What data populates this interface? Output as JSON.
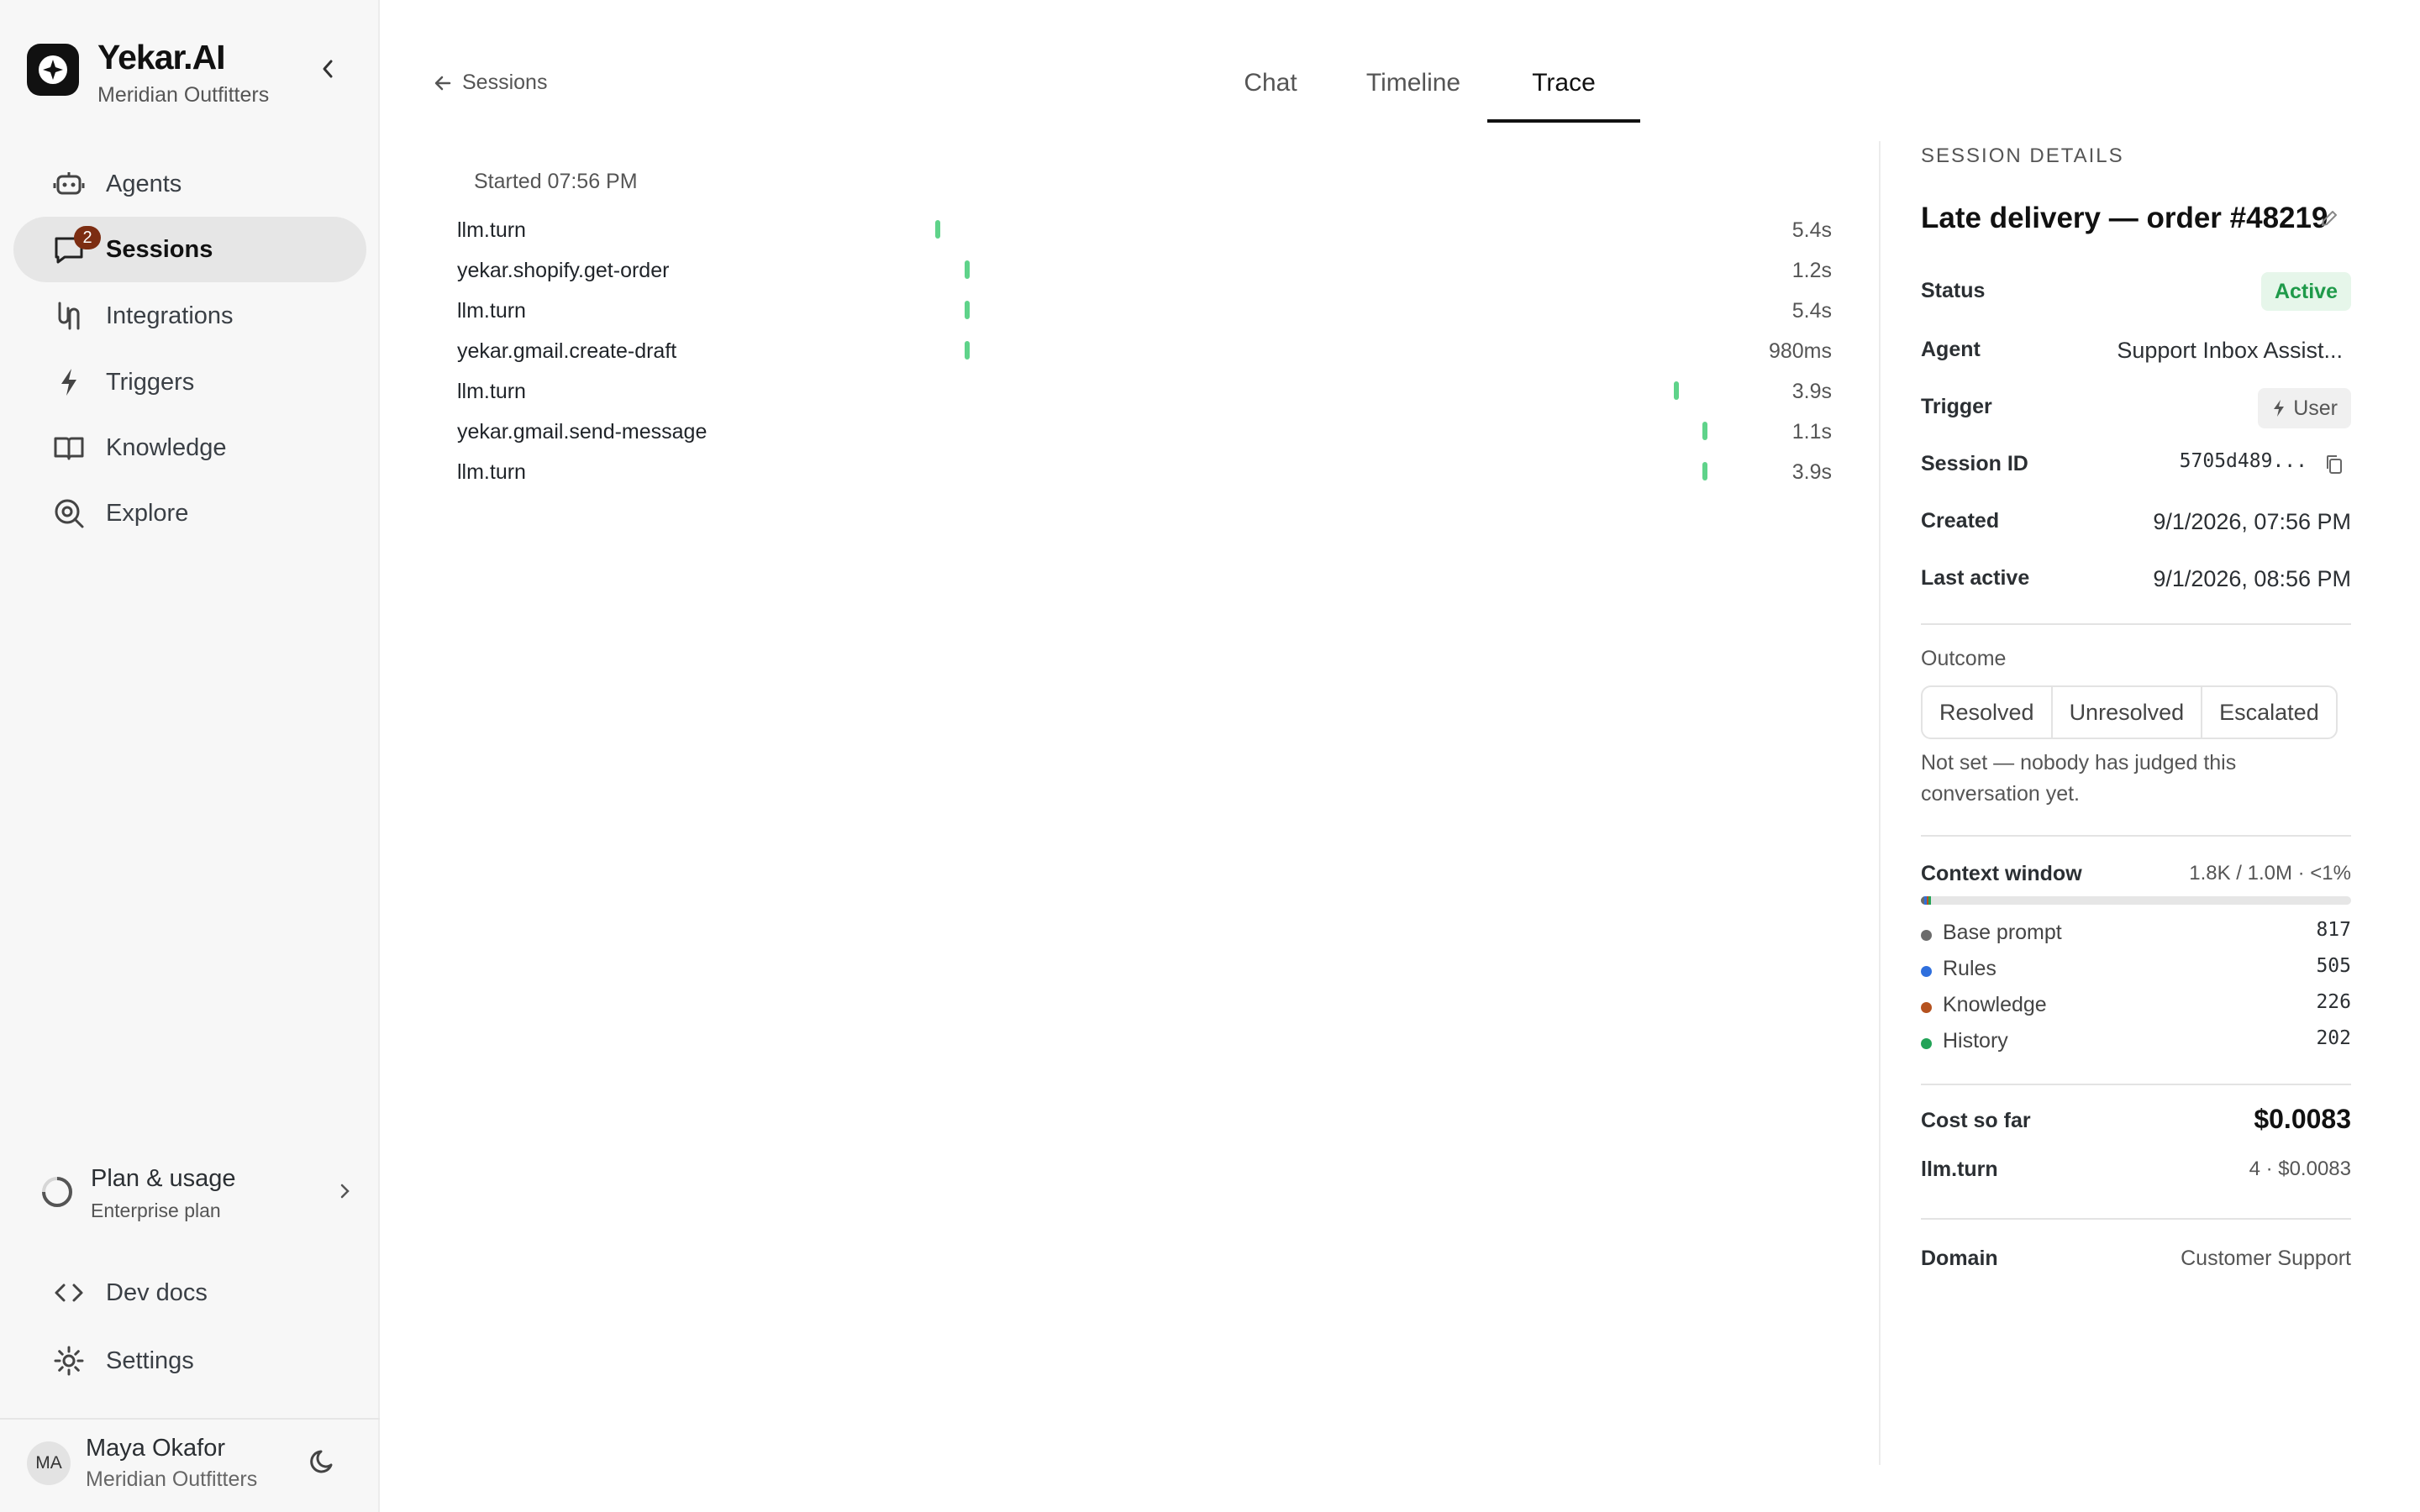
{
  "app": {
    "name": "Yekar.AI",
    "org": "Meridian Outfitters"
  },
  "nav": {
    "items": [
      {
        "label": "Agents",
        "icon": "robot-icon"
      },
      {
        "label": "Sessions",
        "icon": "chat-icon",
        "badge": "2",
        "active": true
      },
      {
        "label": "Integrations",
        "icon": "integrations-icon"
      },
      {
        "label": "Triggers",
        "icon": "bolt-icon"
      },
      {
        "label": "Knowledge",
        "icon": "book-icon"
      },
      {
        "label": "Explore",
        "icon": "explore-icon"
      }
    ],
    "plan": {
      "title": "Plan & usage",
      "subtitle": "Enterprise plan"
    },
    "dev_docs": "Dev docs",
    "settings": "Settings"
  },
  "user": {
    "initials": "MA",
    "name": "Maya Okafor",
    "org": "Meridian Outfitters"
  },
  "header": {
    "back_label": "Sessions",
    "tabs": [
      {
        "label": "Chat",
        "active": false
      },
      {
        "label": "Timeline",
        "active": false
      },
      {
        "label": "Trace",
        "active": true
      }
    ]
  },
  "trace": {
    "started": "Started 07:56 PM",
    "rows": [
      {
        "name": "llm.turn",
        "duration": "5.4s",
        "offset": 0.348
      },
      {
        "name": "yekar.shopify.get-order",
        "duration": "1.2s",
        "offset": 0.369
      },
      {
        "name": "llm.turn",
        "duration": "5.4s",
        "offset": 0.369
      },
      {
        "name": "yekar.gmail.create-draft",
        "duration": "980ms",
        "offset": 0.369
      },
      {
        "name": "llm.turn",
        "duration": "3.9s",
        "offset": 0.885
      },
      {
        "name": "yekar.gmail.send-message",
        "duration": "1.1s",
        "offset": 0.906
      },
      {
        "name": "llm.turn",
        "duration": "3.9s",
        "offset": 0.906
      }
    ]
  },
  "session": {
    "heading": "SESSION DETAILS",
    "title": "Late delivery — order #48219",
    "status_label": "Status",
    "status": "Active",
    "agent_label": "Agent",
    "agent": "Support Inbox Assist...",
    "trigger_label": "Trigger",
    "trigger": "User",
    "session_id_label": "Session ID",
    "session_id": "5705d489...",
    "created_label": "Created",
    "created": "9/1/2026, 07:56 PM",
    "last_active_label": "Last active",
    "last_active": "9/1/2026, 08:56 PM",
    "outcome_label": "Outcome",
    "outcome_options": [
      "Resolved",
      "Unresolved",
      "Escalated"
    ],
    "outcome_note": "Not set — nobody has judged this conversation yet.",
    "context": {
      "label": "Context window",
      "summary": "1.8K / 1.0M · <1%",
      "items": [
        {
          "name": "Base prompt",
          "value": "817",
          "color": "#6b6b6b"
        },
        {
          "name": "Rules",
          "value": "505",
          "color": "#2f6fdd"
        },
        {
          "name": "Knowledge",
          "value": "226",
          "color": "#b5521f"
        },
        {
          "name": "History",
          "value": "202",
          "color": "#22a357"
        }
      ]
    },
    "cost_label": "Cost so far",
    "cost": "$0.0083",
    "cost_item_label": "llm.turn",
    "cost_item_value": "4 · $0.0083",
    "domain_label": "Domain",
    "domain": "Customer Support"
  },
  "colors": {
    "accent": "#111111",
    "status_green": "#1f9a4a",
    "trace_bar": "#5fd38a",
    "badge": "#7c2d12"
  }
}
